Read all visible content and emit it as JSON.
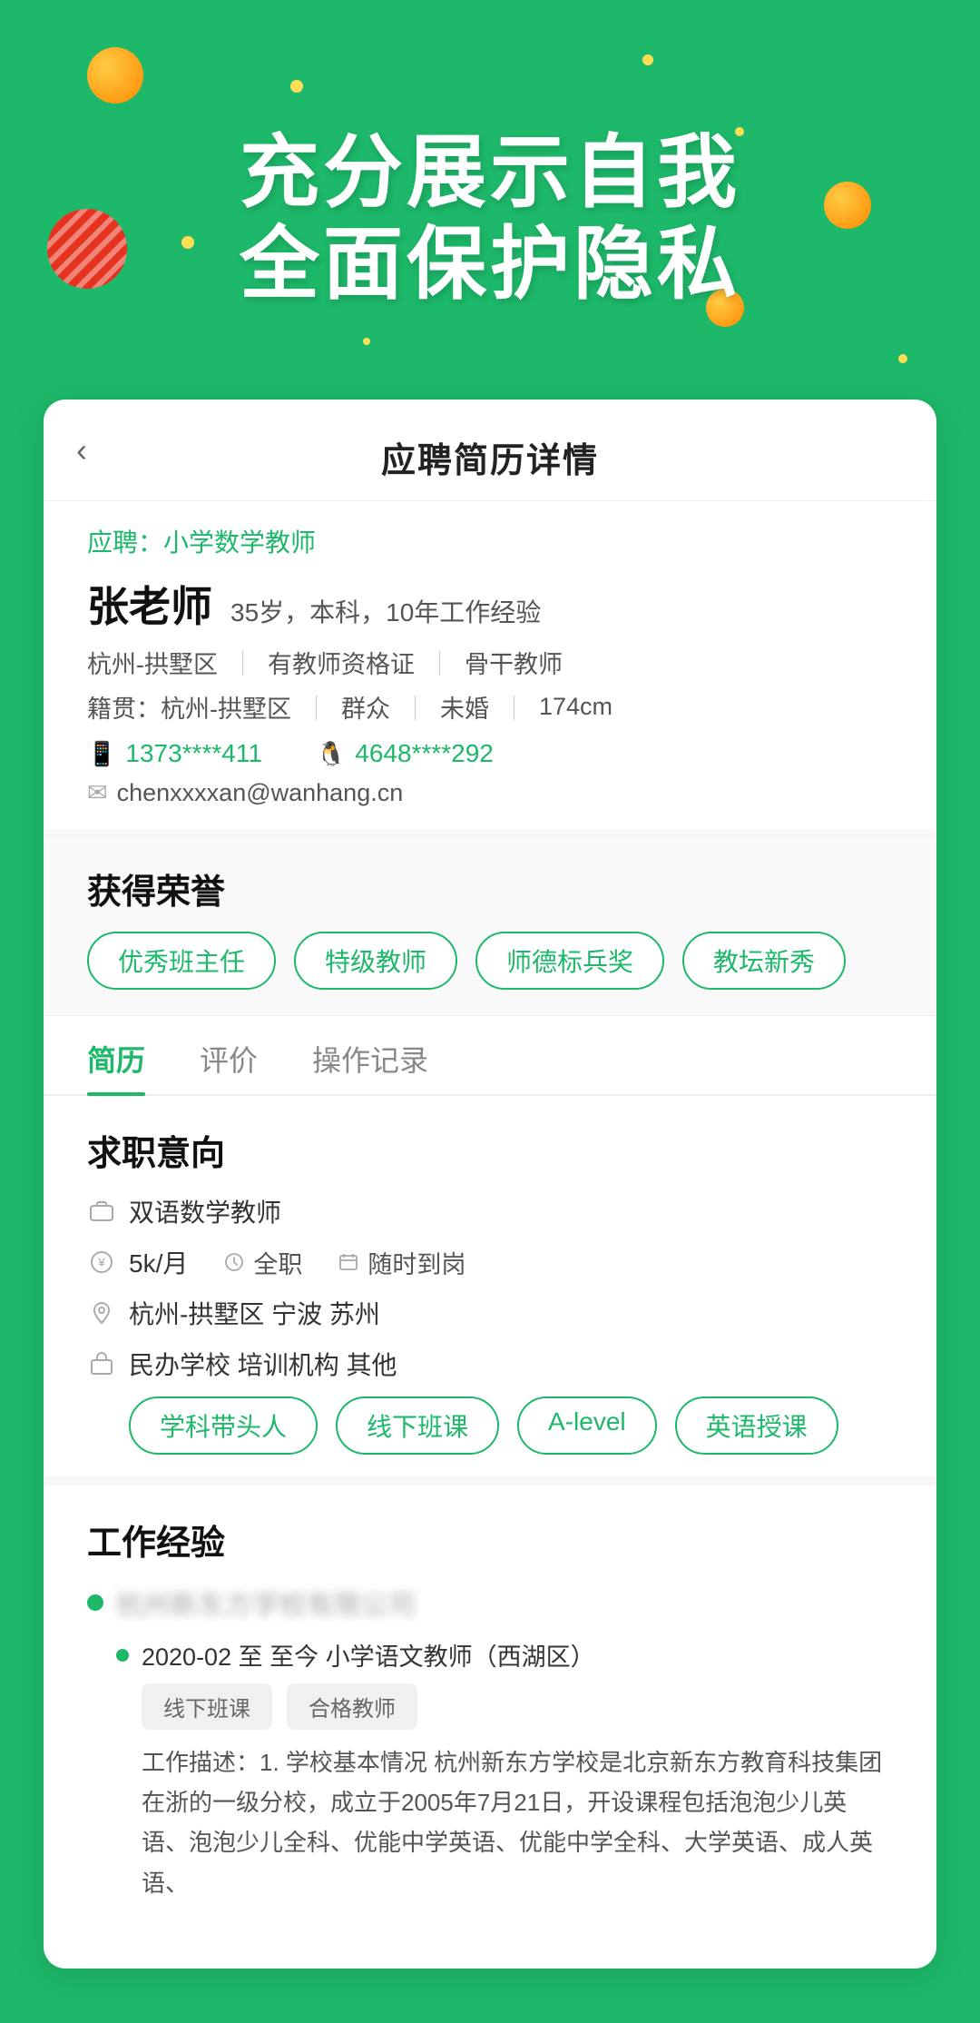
{
  "hero": {
    "title_line1": "充分展示自我",
    "title_line2": "全面保护隐私"
  },
  "card": {
    "header": {
      "back_label": "‹",
      "title": "应聘简历详情"
    },
    "apply_tag": "应聘：小学数学教师",
    "profile": {
      "name": "张老师",
      "meta": "35岁，本科，10年工作经验",
      "info1_parts": [
        "杭州-拱墅区",
        "有教师资格证",
        "骨干教师"
      ],
      "info2_parts": [
        "籍贯：杭州-拱墅区",
        "群众",
        "未婚",
        "174cm"
      ],
      "phone": "1373****411",
      "qq": "4648****292",
      "email": "chenxxxxan@wanhang.cn"
    },
    "honors": {
      "title": "获得荣誉",
      "tags": [
        "优秀班主任",
        "特级教师",
        "师德标兵奖",
        "教坛新秀"
      ]
    },
    "tabs": [
      {
        "label": "简历",
        "active": true
      },
      {
        "label": "评价",
        "active": false
      },
      {
        "label": "操作记录",
        "active": false
      }
    ],
    "job_intent": {
      "title": "求职意向",
      "job_title": "双语数学教师",
      "salary": "5k/月",
      "job_type": "全职",
      "available": "随时到岗",
      "locations": "杭州-拱墅区  宁波  苏州",
      "org_types": "民办学校   培训机构   其他",
      "skill_tags": [
        "学科带头人",
        "线下班课",
        "A-level",
        "英语授课"
      ]
    },
    "work_exp": {
      "title": "工作经验",
      "company_name": "杭州新东方学校",
      "period": "2020-02 至 至今 小学语文教师（西湖区）",
      "work_tags": [
        "线下班课",
        "合格教师"
      ],
      "description": "工作描述：1. 学校基本情况 杭州新东方学校是北京新东方教育科技集团在浙的一级分校，成立于2005年7月21日，开设课程包括泡泡少儿英语、泡泡少儿全科、优能中学英语、优能中学全科、大学英语、成人英语、"
    }
  }
}
